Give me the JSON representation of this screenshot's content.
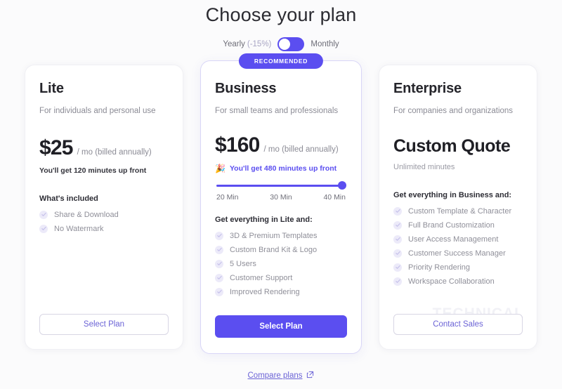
{
  "header": {
    "title": "Choose your plan",
    "billing_toggle": {
      "left_label": "Yearly",
      "left_discount": "(-15%)",
      "right_label": "Monthly",
      "state": "yearly",
      "accent_color": "#5b4ef0"
    }
  },
  "plans": [
    {
      "id": "lite",
      "name": "Lite",
      "description": "For individuals and personal use",
      "price_amount": "$25",
      "price_period": "/ mo (billed annually)",
      "price_note": "You'll get 120 minutes up front",
      "features_title": "What's included",
      "features": [
        "Share & Download",
        "No Watermark"
      ],
      "cta_label": "Select Plan",
      "recommended": false
    },
    {
      "id": "business",
      "name": "Business",
      "description": "For small teams and professionals",
      "badge": "RECOMMENDED",
      "price_amount": "$160",
      "price_period": "/ mo (billed annually)",
      "price_note": "You'll get 480 minutes up front",
      "note_icon": "party-popper-icon",
      "note_emoji": "🎉",
      "slider": {
        "value_label": "40 Min",
        "ticks": [
          "20 Min",
          "30 Min",
          "40 Min"
        ],
        "position_percent": 100
      },
      "features_title": "Get everything in Lite and:",
      "features": [
        "3D & Premium Templates",
        "Custom Brand Kit & Logo",
        "5 Users",
        "Customer Support",
        "Improved Rendering"
      ],
      "cta_label": "Select Plan",
      "recommended": true
    },
    {
      "id": "enterprise",
      "name": "Enterprise",
      "description": "For companies and organizations",
      "price_amount": "Custom Quote",
      "price_period": "",
      "price_note": "Unlimited minutes",
      "features_title": "Get everything in Business and:",
      "features": [
        "Custom Template & Character",
        "Full Brand Customization",
        "User Access Management",
        "Customer Success Manager",
        "Priority Rendering",
        "Workspace Collaboration"
      ],
      "cta_label": "Contact Sales",
      "recommended": false
    }
  ],
  "footer": {
    "compare_label": "Compare plans",
    "compare_icon": "external-link-icon"
  },
  "watermark": {
    "text": "TECHNICAL"
  }
}
